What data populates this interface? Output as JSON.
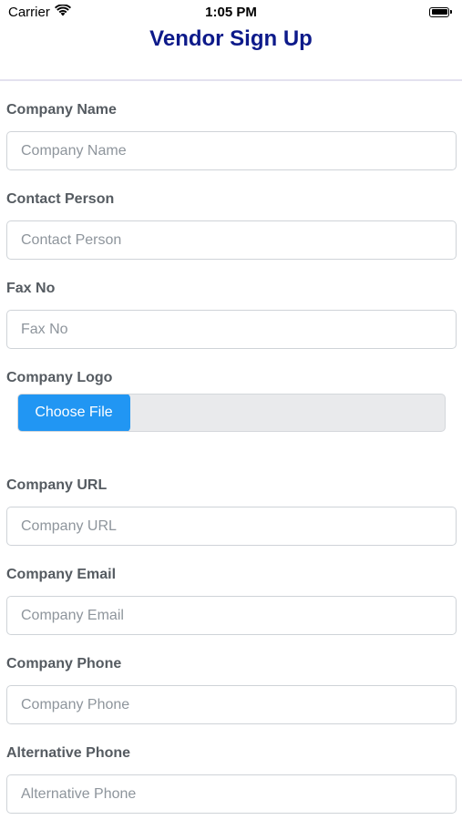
{
  "status_bar": {
    "carrier": "Carrier",
    "time": "1:05 PM",
    "wifi_icon": "wifi-icon",
    "battery_icon": "battery-icon"
  },
  "header": {
    "title": "Vendor Sign Up",
    "title_color": "#0d1a8a"
  },
  "form": {
    "company_name": {
      "label": "Company Name",
      "placeholder": "Company Name",
      "value": ""
    },
    "contact_person": {
      "label": "Contact Person",
      "placeholder": "Contact Person",
      "value": ""
    },
    "fax_no": {
      "label": "Fax No",
      "placeholder": "Fax No",
      "value": ""
    },
    "company_logo": {
      "label": "Company Logo",
      "button_label": "Choose File",
      "button_color": "#2196f3"
    },
    "company_url": {
      "label": "Company URL",
      "placeholder": "Company URL",
      "value": ""
    },
    "company_email": {
      "label": "Company Email",
      "placeholder": "Company Email",
      "value": ""
    },
    "company_phone": {
      "label": "Company Phone",
      "placeholder": "Company Phone",
      "value": ""
    },
    "alternative_phone": {
      "label": "Alternative Phone",
      "placeholder": "Alternative Phone",
      "value": ""
    }
  }
}
